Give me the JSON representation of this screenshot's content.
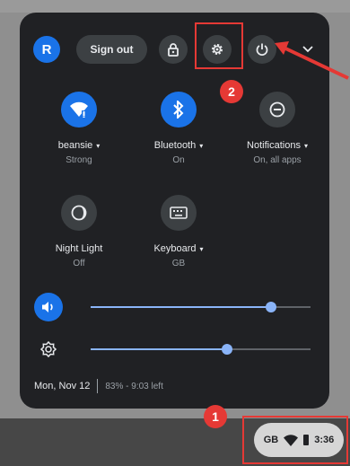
{
  "user": {
    "avatar_letter": "R"
  },
  "header": {
    "sign_out_label": "Sign out",
    "lock_icon": "lock-icon",
    "settings_icon": "gear-icon",
    "power_icon": "power-icon",
    "collapse_icon": "chevron-down-icon"
  },
  "tiles": [
    {
      "title": "beansie",
      "sub": "Strong",
      "icon": "wifi-icon",
      "active": true,
      "has_menu": true
    },
    {
      "title": "Bluetooth",
      "sub": "On",
      "icon": "bluetooth-icon",
      "active": true,
      "has_menu": true
    },
    {
      "title": "Notifications",
      "sub": "On, all apps",
      "icon": "do-not-disturb-icon",
      "active": false,
      "has_menu": true
    },
    {
      "title": "Night Light",
      "sub": "Off",
      "icon": "night-light-icon",
      "active": false,
      "has_menu": false
    },
    {
      "title": "Keyboard",
      "sub": "GB",
      "icon": "keyboard-icon",
      "active": false,
      "has_menu": true
    }
  ],
  "caret": "▾",
  "sliders": {
    "volume": {
      "icon": "volume-icon",
      "level": 0.82
    },
    "brightness": {
      "icon": "brightness-icon",
      "level": 0.62
    }
  },
  "footer": {
    "date": "Mon, Nov 12",
    "battery": "83% - 9:03 left"
  },
  "annotations": {
    "badge_1": "1",
    "badge_2": "2"
  },
  "tray": {
    "keyboard_layout": "GB",
    "time": "3:36"
  },
  "colors": {
    "panel": "#202124",
    "accent": "#1a73e8",
    "highlight": "#e53935"
  }
}
